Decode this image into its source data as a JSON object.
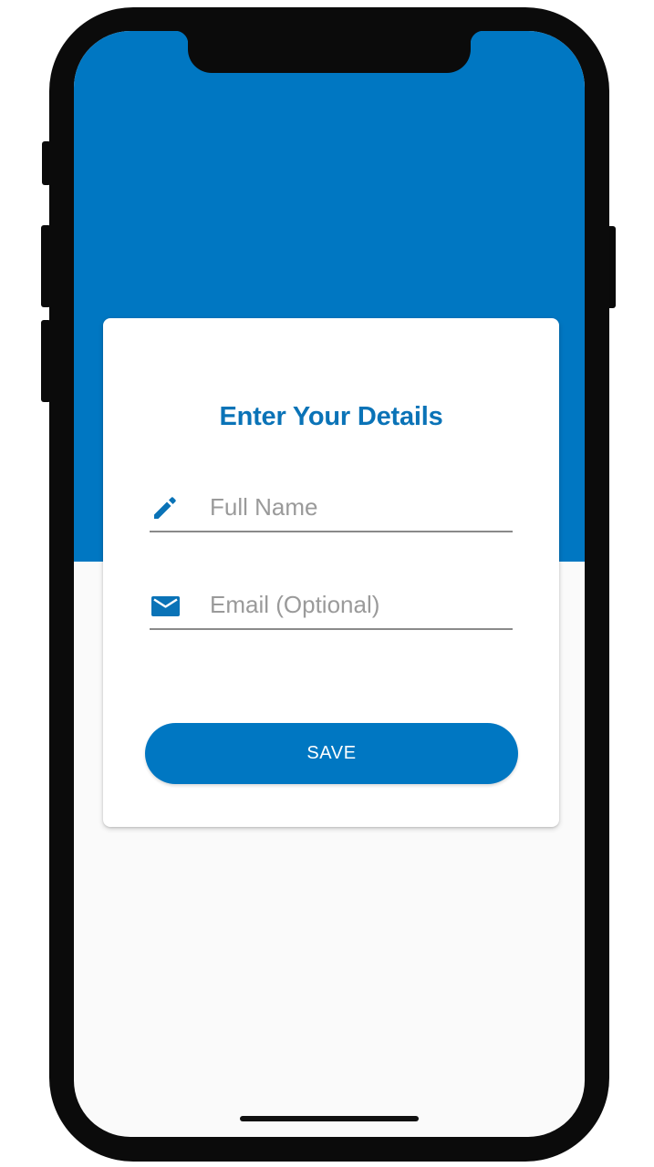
{
  "theme": {
    "primary": "#0077C2",
    "title_color": "#0A73B7",
    "background": "#FAFAFA",
    "card": "#FFFFFF",
    "frame": "#0B0B0B"
  },
  "form": {
    "title": "Enter Your Details",
    "fields": [
      {
        "icon": "pencil-icon",
        "placeholder": "Full Name",
        "value": ""
      },
      {
        "icon": "email-icon",
        "placeholder": "Email (Optional)",
        "value": ""
      }
    ],
    "save_label": "SAVE"
  }
}
